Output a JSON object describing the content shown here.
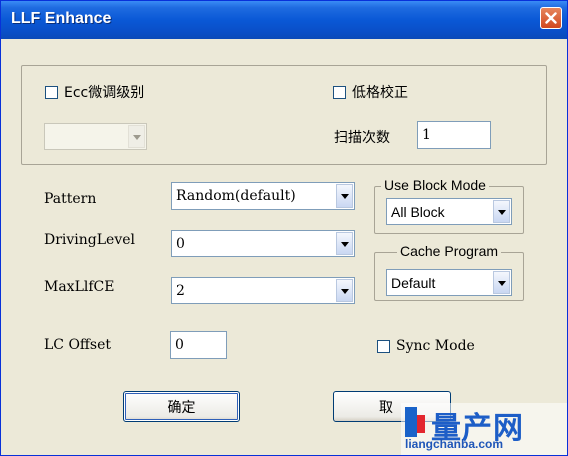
{
  "window": {
    "title": "LLF Enhance"
  },
  "top_group": {
    "ecc_label": "Ecc微调级别",
    "ecc_checked": false,
    "ecc_combo_value": "",
    "low_format_label": "低格校正",
    "low_format_checked": false,
    "scan_label": "扫描次数",
    "scan_value": "1"
  },
  "fields": {
    "pattern_label": "Pattern",
    "pattern_value": "Random(default)",
    "driving_label": "DrivingLevel",
    "driving_value": "0",
    "maxllf_label": "MaxLlfCE",
    "maxllf_value": "2",
    "lc_offset_label": "LC Offset",
    "lc_offset_value": "0"
  },
  "use_block_mode": {
    "legend": "Use Block Mode",
    "value": "All Block"
  },
  "cache_program": {
    "legend": "Cache Program",
    "value": "Default"
  },
  "sync_mode": {
    "label": "Sync Mode",
    "checked": false
  },
  "buttons": {
    "ok": "确定",
    "cancel": "取"
  },
  "watermark": {
    "text": "量产网",
    "url": "liangchanba.com"
  }
}
